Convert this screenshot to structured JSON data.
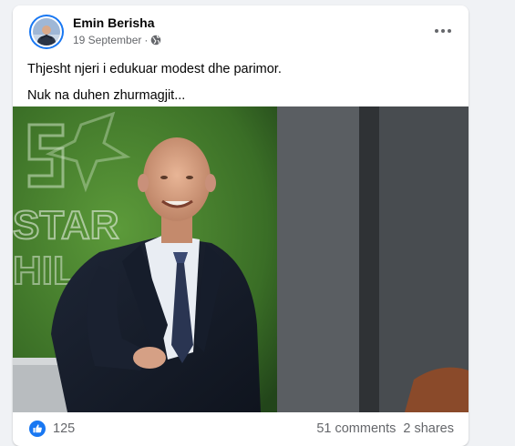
{
  "post": {
    "author": "Emin Berisha",
    "date": "19 September",
    "separator": "·",
    "privacy_icon": "globe-icon",
    "more_icon": "more-options-icon",
    "text_lines": [
      "Thjesht njeri i edukuar modest dhe parimor.",
      "Nuk na duhen zhurmagjit..."
    ],
    "photo_icon": "post-photo",
    "reaction_icon": "like-reaction-icon",
    "reactions_count": "125",
    "comments": "51 comments",
    "shares": "2 shares"
  },
  "colors": {
    "background": "#f0f2f5",
    "card": "#ffffff",
    "primary_text": "#050505",
    "secondary_text": "#65676b",
    "accent": "#1877f2"
  }
}
